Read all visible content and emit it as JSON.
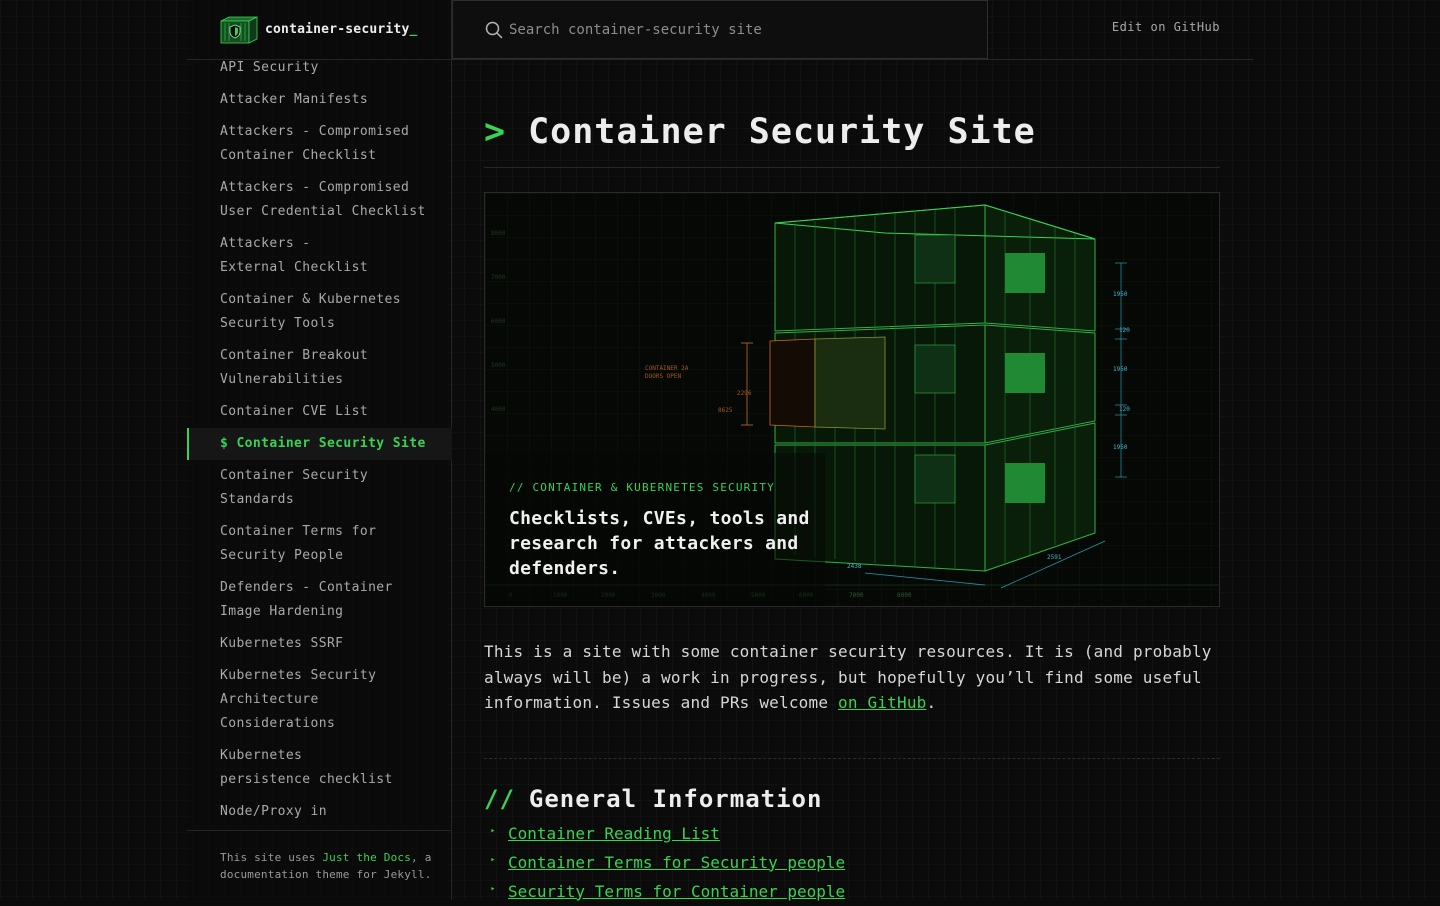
{
  "header": {
    "site_title": "container-security",
    "cursor": "_",
    "search_placeholder": "Search container-security site",
    "edit_link": "Edit on GitHub"
  },
  "sidebar": {
    "items": [
      {
        "label": "API Security",
        "active": false
      },
      {
        "label": "Attacker Manifests",
        "active": false
      },
      {
        "label": "Attackers - Compromised\nContainer Checklist",
        "active": false
      },
      {
        "label": "Attackers - Compromised\nUser Credential Checklist",
        "active": false
      },
      {
        "label": "Attackers -\nExternal Checklist",
        "active": false
      },
      {
        "label": "Container & Kubernetes\nSecurity Tools",
        "active": false
      },
      {
        "label": "Container Breakout\nVulnerabilities",
        "active": false
      },
      {
        "label": "Container CVE List",
        "active": false
      },
      {
        "label": "$ Container Security Site",
        "active": true
      },
      {
        "label": "Container Security\nStandards",
        "active": false
      },
      {
        "label": "Container Terms for\nSecurity People",
        "active": false
      },
      {
        "label": "Defenders - Container\nImage Hardening",
        "active": false
      },
      {
        "label": "Kubernetes SSRF",
        "active": false
      },
      {
        "label": "Kubernetes Security\nArchitecture\nConsiderations",
        "active": false
      },
      {
        "label": "Kubernetes\npersistence checklist",
        "active": false
      },
      {
        "label": "Node/Proxy in",
        "active": false
      }
    ],
    "footer": {
      "prefix": "This site uses ",
      "link_text": "Just the Docs",
      "suffix": ", a documentation theme for Jekyll."
    }
  },
  "main": {
    "prompt": ">",
    "title": "Container Security Site",
    "hero": {
      "kicker": "// CONTAINER & KUBERNETES SECURITY",
      "headline": "Checklists, CVEs, tools and research for attackers and defenders.",
      "annotations": {
        "door_label_1": "CONTAINER 2A",
        "door_label_2": "DOORS OPEN",
        "dim_1950": "1950",
        "dim_120": "120",
        "dim_2438": "2438",
        "dim_2591": "2591",
        "dim_2296": "2296",
        "dim_8625": "8625",
        "x_ticks": [
          "0",
          "1000",
          "2000",
          "3000",
          "4000",
          "5000",
          "6000",
          "7000",
          "8000"
        ],
        "y_ticks": [
          "8000",
          "7000",
          "6000",
          "5000",
          "4000"
        ]
      }
    },
    "intro_text": "This is a site with some container security resources. It is (and probably always will be) a work in progress, but hopefully you’ll find some useful information. Issues and PRs welcome ",
    "intro_link": "on GitHub",
    "intro_end": ".",
    "section": {
      "slashes": "//",
      "title": "General Information",
      "links": [
        "Container Reading List",
        "Container Terms for Security people",
        "Security Terms for Container people"
      ],
      "bullet": "‣"
    }
  },
  "colors": {
    "accent": "#39d353",
    "background": "#0b0b0b",
    "text": "#c9c9c9"
  }
}
